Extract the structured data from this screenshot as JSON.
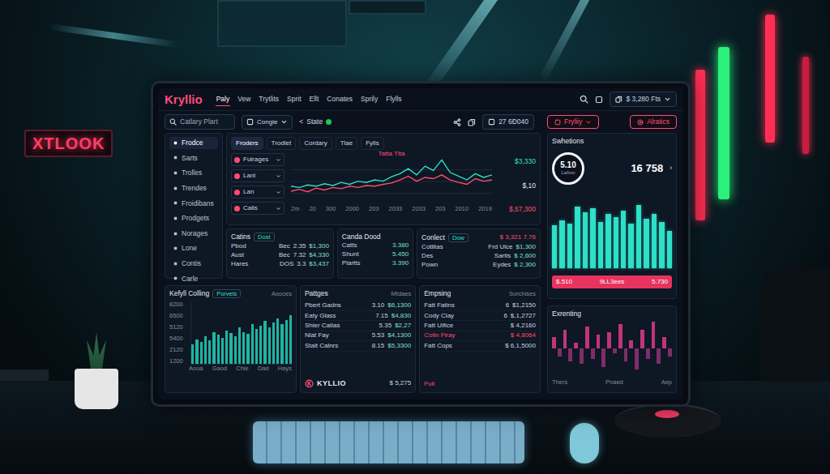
{
  "scene": {
    "sign": "XTLOOK"
  },
  "header": {
    "logo": "Kryllio",
    "menu": [
      {
        "label": "Paly",
        "selected": true
      },
      {
        "label": "Vew",
        "selected": false
      },
      {
        "label": "Trytlits",
        "selected": false
      },
      {
        "label": "Sprit",
        "selected": false
      },
      {
        "label": "Ellt",
        "selected": false
      },
      {
        "label": "Conates",
        "selected": false
      },
      {
        "label": "Sprily",
        "selected": false
      },
      {
        "label": "Flylls",
        "selected": false
      }
    ],
    "balance": "$ 3,280 Fts"
  },
  "toolbar": {
    "search": {
      "placeholder": "Catlary Plart"
    },
    "filter": "Congie",
    "state": {
      "back": "<",
      "label": "State",
      "color": "#22c55e"
    },
    "counter": "27 6Ð040",
    "buttons": [
      "Fryliiy",
      "Alratics"
    ]
  },
  "sidebar": {
    "items": [
      {
        "label": "Frodce",
        "selected": true
      },
      {
        "label": "Sarts",
        "selected": false
      },
      {
        "label": "Trolles",
        "selected": false
      },
      {
        "label": "Trendes",
        "selected": false
      },
      {
        "label": "Froidibans",
        "selected": false
      },
      {
        "label": "Prodgets",
        "selected": false
      },
      {
        "label": "Norages",
        "selected": false
      },
      {
        "label": "Lone",
        "selected": false
      },
      {
        "label": "Contis",
        "selected": false
      },
      {
        "label": "Carle",
        "selected": false
      }
    ]
  },
  "chart": {
    "tabs": [
      {
        "label": "Froders",
        "selected": true
      },
      {
        "label": "Trodlet",
        "selected": false
      },
      {
        "label": "Cordary",
        "selected": false
      },
      {
        "label": "Tlae",
        "selected": false
      },
      {
        "label": "Fylls",
        "selected": false
      }
    ],
    "legend": [
      {
        "label": "Fulrages",
        "color": "#ff4d6d"
      },
      {
        "label": "Lanl",
        "color": "#ff4d6d"
      },
      {
        "label": "Lan",
        "color": "#ff4d6d"
      },
      {
        "label": "Calis",
        "color": "#ff4d6d"
      }
    ],
    "note": "Tatta Tlta",
    "readings": [
      {
        "text": "$3,330",
        "color": "#2de0c8"
      },
      {
        "text": "$,10",
        "color": "#e2e8f0"
      },
      {
        "text": "$,57,300",
        "color": "#ff4d6d"
      }
    ],
    "series": [
      {
        "color": "#2de0c8",
        "values": [
          30,
          28,
          32,
          30,
          34,
          31,
          36,
          33,
          38,
          36,
          40,
          38,
          45,
          50,
          58,
          48,
          62,
          55,
          72,
          52,
          46,
          40,
          50,
          44,
          48
        ]
      },
      {
        "color": "#ff4d6d",
        "values": [
          22,
          25,
          21,
          27,
          24,
          28,
          26,
          30,
          28,
          31,
          30,
          33,
          35,
          40,
          46,
          38,
          44,
          42,
          48,
          40,
          36,
          33,
          42,
          38,
          40
        ]
      }
    ],
    "x_ticks": [
      "2m",
      "20",
      "300",
      "2000",
      "203",
      "2033",
      "2033",
      "203",
      "2010",
      "2019"
    ]
  },
  "cards": [
    {
      "title": "Catins",
      "badge": "Dost",
      "value": "",
      "rows": [
        [
          "Pbod",
          "Bec",
          "2.35",
          "$1,300"
        ],
        [
          "Aust",
          "Bec",
          "7.32",
          "$4,330"
        ],
        [
          "Hares",
          "DOS",
          "3.3",
          "$3,437"
        ]
      ]
    },
    {
      "title": "Canda Dood",
      "badge": "",
      "value": "",
      "rows": [
        [
          "Catts",
          "3.380"
        ],
        [
          "Shunt",
          "5.450"
        ],
        [
          "Plartts",
          "3.390"
        ]
      ]
    },
    {
      "title": "Conlect",
      "badge": "Dow",
      "value": "$ 3,321 7.76",
      "rows": [
        [
          "Cotlitas",
          "Frd Ulce",
          "$1,300"
        ],
        [
          "Des",
          "Sartis",
          "$ 2,600"
        ],
        [
          "Pown",
          "Eydes",
          "$ 2,300"
        ]
      ]
    }
  ],
  "bottom": {
    "activity": {
      "title": "Kefyll Colling",
      "subtitle": "Porvels",
      "aside": "Aooces",
      "y_ticks": [
        "8200",
        "6500",
        "5120",
        "5400",
        "2120",
        "1200"
      ],
      "x_ticks": [
        "Aooa",
        "Gaod",
        "Chie",
        "Dad",
        "Hays"
      ],
      "values": [
        2600,
        3200,
        2900,
        3600,
        3100,
        4200,
        3800,
        3400,
        4400,
        4000,
        3600,
        4800,
        4200,
        3900,
        5200,
        4600,
        5000,
        5600,
        4800,
        5400,
        6000,
        5200,
        5800,
        6400
      ]
    },
    "packages": {
      "title": "Pattges",
      "aside": "Mtdaes",
      "rows": [
        [
          "Pbert Gadns",
          "3.10",
          "$6,1300"
        ],
        [
          "Eaty Glass",
          "7.15",
          "$4,830"
        ],
        [
          "Shier Catias",
          "5.35",
          "$2,27"
        ],
        [
          "Nlat Fay",
          "5.53",
          "$4,1300"
        ],
        [
          "Stalt Calnrs",
          "8.15",
          "$5,3300"
        ]
      ],
      "footer": {
        "logo": "KYLLIO",
        "value": "$ 5,275"
      }
    },
    "earnings": {
      "title": "Empsing",
      "aside": "Sorchises",
      "rows": [
        {
          "cells": [
            "Fatt Fatins",
            "6",
            "$1,2150"
          ],
          "alert": false
        },
        {
          "cells": [
            "Cody Clay",
            "6",
            "$,1,2727"
          ],
          "alert": false
        },
        {
          "cells": [
            "Fatt Uifice",
            "",
            "$ 4,2160"
          ],
          "alert": false
        },
        {
          "cells": [
            "Colin Firay",
            "",
            "$ 4,8064"
          ],
          "alert": true
        },
        {
          "cells": [
            "Fatt Cops",
            "",
            "$ 6,1,5000"
          ],
          "alert": false
        }
      ],
      "footer": "Fuli"
    }
  },
  "summary": {
    "title": "Swhetions",
    "gauge": {
      "value": "5.10",
      "label": "Lafissi"
    },
    "total": "16 758",
    "arrow": "›",
    "bars": [
      55,
      62,
      58,
      80,
      72,
      78,
      60,
      70,
      66,
      74,
      58,
      82,
      64,
      70,
      60,
      48
    ],
    "strip": [
      "$.510",
      "9LL3ees",
      "5.730"
    ]
  },
  "trend": {
    "title": "Exrenting",
    "bars": [
      20,
      -15,
      35,
      -25,
      10,
      -30,
      40,
      -20,
      25,
      -35,
      30,
      -10,
      45,
      -25,
      15,
      -40,
      35,
      -20,
      50,
      -30,
      20,
      -15
    ],
    "x_ticks": [
      "Thers",
      "Pnaed",
      "Aep"
    ]
  }
}
